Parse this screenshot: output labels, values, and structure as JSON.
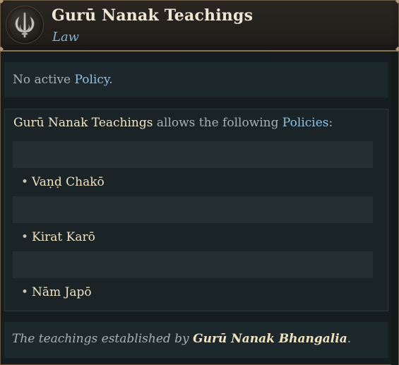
{
  "header": {
    "title": "Gurū Nanak Teachings",
    "subtitle": "Law",
    "emblem_icon": "khanda-icon"
  },
  "active_policy": {
    "prefix": "No active ",
    "link": "Policy",
    "suffix": "."
  },
  "policies": {
    "intro_subject": "Gurū Nanak Teachings",
    "intro_middle": " allows the following ",
    "intro_link": "Policies",
    "intro_suffix": ":",
    "items": [
      {
        "bullet": "•",
        "label": "Vaṇḍ Chakō"
      },
      {
        "bullet": "•",
        "label": "Kirat Karō"
      },
      {
        "bullet": "•",
        "label": "Nām Japō"
      }
    ]
  },
  "footer": {
    "prefix": "The teachings established by ",
    "name": "Gurū Nanak Bhangalia",
    "suffix": "."
  },
  "colors": {
    "accent_link": "#8ec3e6",
    "subtitle_blue": "#7fb4d6",
    "title_text": "#efe6d6",
    "border_gold": "#8a7458"
  }
}
